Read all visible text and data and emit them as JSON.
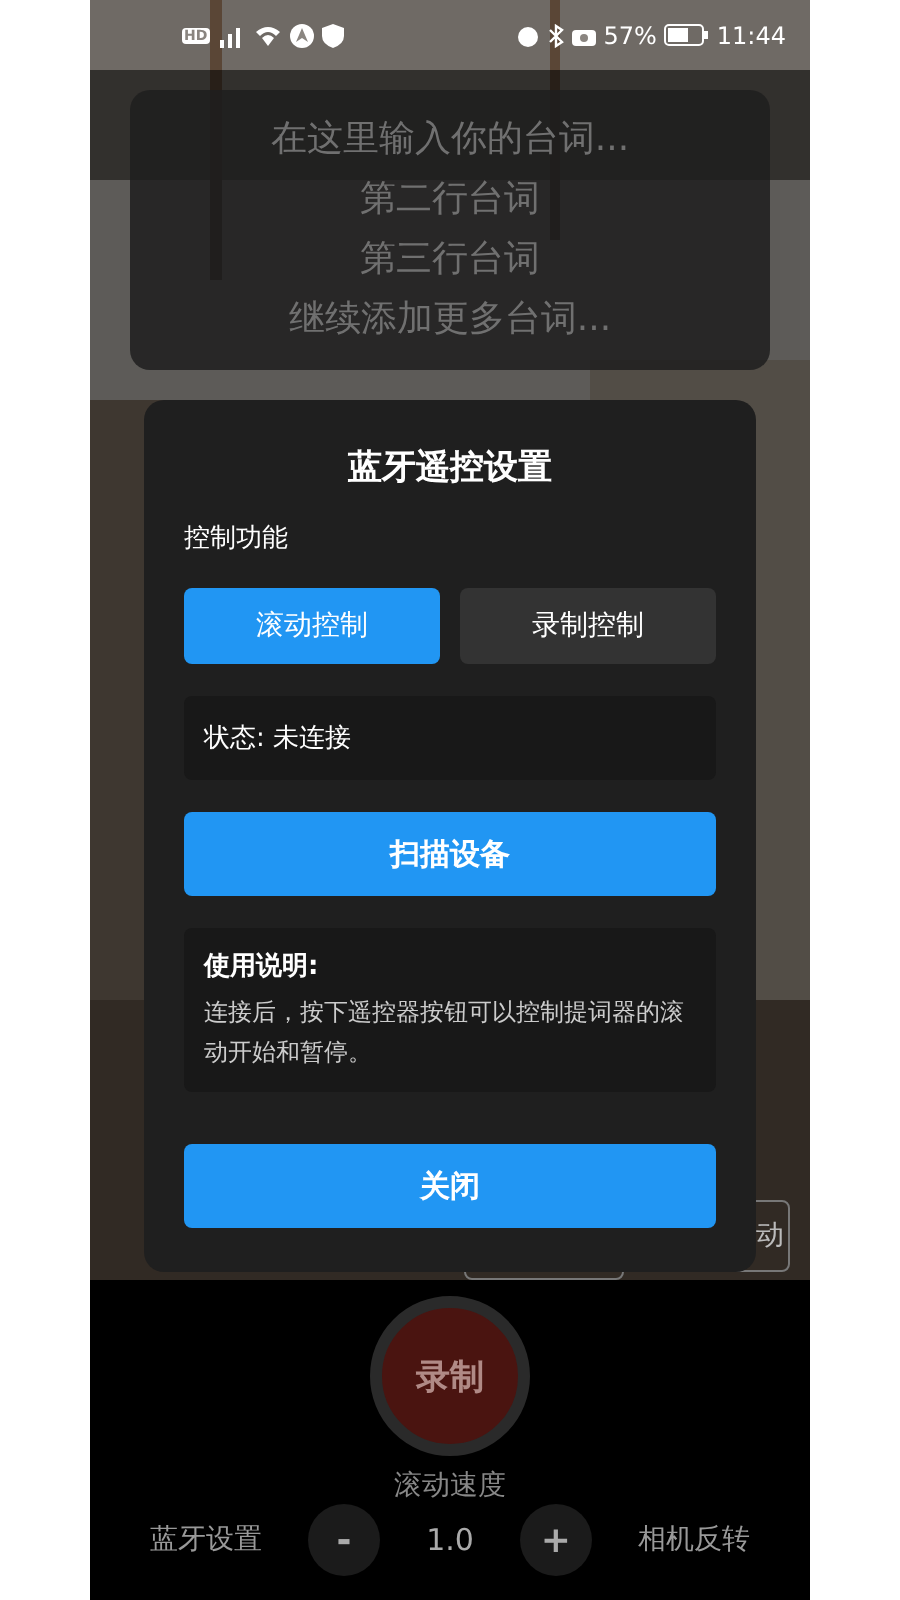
{
  "status_bar": {
    "badge": "HD",
    "battery": "57%",
    "time": "11:44"
  },
  "script_lines": [
    "在这里输入你的台词...",
    "第二行台词",
    "第三行台词",
    "继续添加更多台词..."
  ],
  "hidden_buttons": {
    "right_label": "动"
  },
  "dialog": {
    "title": "蓝牙遥控设置",
    "section_label": "控制功能",
    "modes": [
      {
        "label": "滚动控制",
        "selected": true
      },
      {
        "label": "录制控制",
        "selected": false
      }
    ],
    "status": "状态: 未连接",
    "scan_button": "扫描设备",
    "help": {
      "title": "使用说明:",
      "text": "连接后，按下遥控器按钮可以控制提词器的滚动开始和暂停。"
    },
    "close_button": "关闭"
  },
  "record_button": "录制",
  "speed": {
    "label": "滚动速度",
    "minus": "-",
    "value": "1.0",
    "plus": "+"
  },
  "bluetooth_settings": "蓝牙设置",
  "camera_flip": "相机反转"
}
